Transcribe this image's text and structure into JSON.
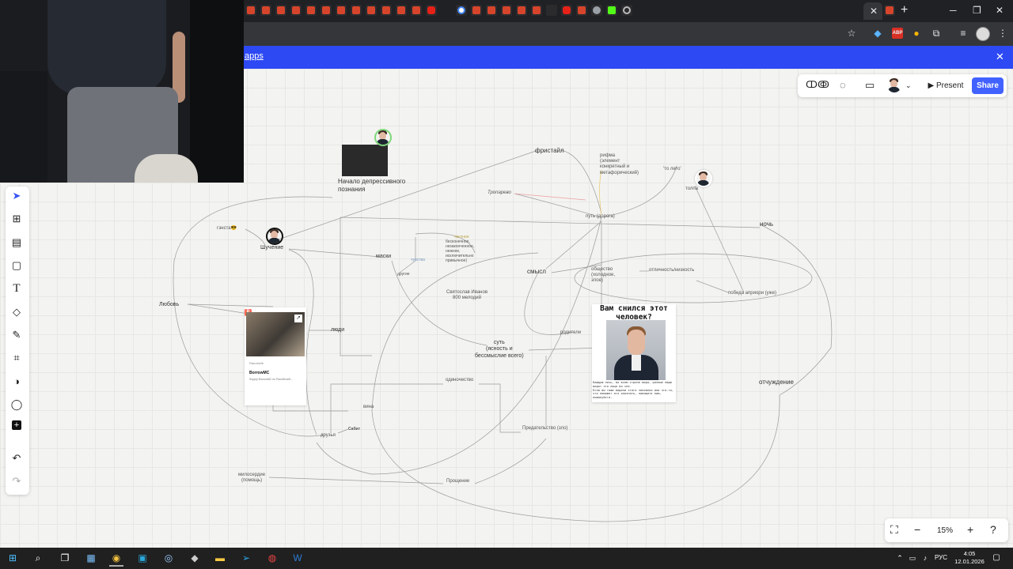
{
  "browser": {
    "banner_text": "apps",
    "tab_icons": [
      "tab-icon",
      "tab-icon",
      "tab-icon",
      "tab-icon",
      "tab-icon",
      "tab-icon",
      "tab-icon",
      "tab-icon",
      "tab-icon",
      "tab-icon",
      "tab-icon",
      "tab-icon",
      "youtube-icon",
      "google-icon",
      "tab-icon",
      "tab-icon",
      "tab-icon",
      "tab-icon",
      "tab-icon",
      "vk-icon",
      "youtube-icon",
      "tab-icon",
      "globe-icon",
      "kick-icon",
      "sound-icon"
    ]
  },
  "board": {
    "toolbar": {
      "present_label": "Present",
      "share_label": "Share"
    },
    "zoom": {
      "value": "15%"
    },
    "nodes": {
      "depressive": "Начало депрессивного\nпознания",
      "freestyle": "фристайл",
      "rhyme": "рифма\n(элемент\nконкретный и\nметафорический)",
      "to_leto": "'то лето'",
      "tolpa": "толпа",
      "troparevo": "Тропарево",
      "put": "путь (дорога)",
      "noch": "ночь",
      "gangsta": "гэнста😎",
      "shuchenie": "Шучение",
      "maski": "маски",
      "infinite": "бесконечное,\nнезаконченное,\nнежное,\nисключительно\nпривычное)",
      "small_top": "частное",
      "small_mid": "чувства",
      "small_bot": "другие",
      "smysl": "смысл",
      "obshchestvo": "общество\n(холодное,\nзлое)",
      "otlichnost": "отличность/низкость",
      "pobeda": "победа априори (уже)",
      "svyatoslav": "Святослав Иванов\n800 мелодий",
      "lyubov": "Любовь",
      "lyudi": "люди",
      "roditeli": "родители",
      "sut": "суть\n(ясность и\nбессмыслие всего)",
      "odinochestvo": "одиночество",
      "otchuzhdenie": "отчуждение",
      "vina": "вина",
      "sabit": "Сабит",
      "druzya": "друзья",
      "predatelstvo": "Предательство (зло)",
      "miloserdie": "милосердие\n(помощь)",
      "proshchenie": "Прощение"
    },
    "link_card": {
      "source": "Ranobelib",
      "title": "BorrowMC",
      "desc": "Supply BorrowMC по Ранобелиб..."
    },
    "meme_card": {
      "title": "Вам снился этот\nчеловек?",
      "caption": "Каждую ночь, во всем стране мира, разные люди видят это лицо во сне.\nЕсли вы тоже видели этого человека или что-то, что поможет его опознать, напишите нам, пожалуйста."
    }
  },
  "taskbar": {
    "time": "4:05",
    "date": "12.01.2026",
    "lang": "РУС"
  }
}
